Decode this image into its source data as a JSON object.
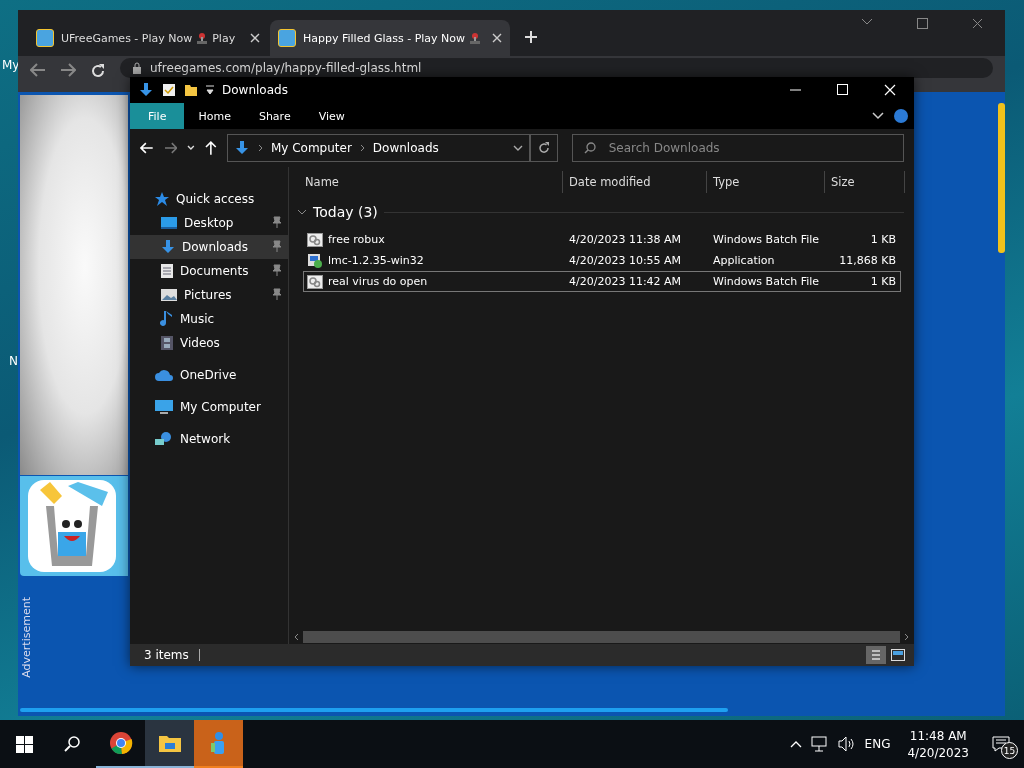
{
  "desktop": {
    "icon_labels": [
      "My",
      "N"
    ]
  },
  "browser": {
    "tabs": [
      {
        "title": "UFreeGames - Play Now",
        "suffix": "Play",
        "selected": false
      },
      {
        "title": "Happy Filled Glass - Play Now",
        "selected": true
      }
    ],
    "address": "ufreegames.com/play/happy-filled-glass.html",
    "page": {
      "ad_label": "Advertisement"
    }
  },
  "explorer": {
    "title": "Downloads",
    "ribbon_tabs": [
      {
        "label": "File",
        "selected": true
      },
      {
        "label": "Home",
        "selected": false
      },
      {
        "label": "Share",
        "selected": false
      },
      {
        "label": "View",
        "selected": false
      }
    ],
    "breadcrumb": [
      "My Computer",
      "Downloads"
    ],
    "search": {
      "placeholder": "Search Downloads"
    },
    "sidebar": [
      {
        "label": "Quick access",
        "children": [
          {
            "label": "Desktop",
            "pinned": true,
            "selected": false
          },
          {
            "label": "Downloads",
            "pinned": true,
            "selected": true
          },
          {
            "label": "Documents",
            "pinned": true,
            "selected": false
          },
          {
            "label": "Pictures",
            "pinned": true,
            "selected": false
          },
          {
            "label": "Music",
            "pinned": false,
            "selected": false
          },
          {
            "label": "Videos",
            "pinned": false,
            "selected": false
          }
        ]
      },
      {
        "label": "OneDrive"
      },
      {
        "label": "My Computer"
      },
      {
        "label": "Network"
      }
    ],
    "columns": [
      "Name",
      "Date modified",
      "Type",
      "Size"
    ],
    "group": {
      "label": "Today (3)",
      "expanded": true
    },
    "rows": [
      {
        "name": "free robux",
        "date": "4/20/2023 11:38 AM",
        "type": "Windows Batch File",
        "size": "1 KB",
        "kind": "batch",
        "focused": false
      },
      {
        "name": "lmc-1.2.35-win32",
        "date": "4/20/2023 10:55 AM",
        "type": "Application",
        "size": "11,868 KB",
        "kind": "app",
        "focused": false
      },
      {
        "name": "real virus do open",
        "date": "4/20/2023 11:42 AM",
        "type": "Windows Batch File",
        "size": "1 KB",
        "kind": "batch",
        "focused": true
      }
    ],
    "status": "3 items",
    "views": [
      {
        "kind": "details",
        "selected": true
      },
      {
        "kind": "tiles",
        "selected": false
      }
    ]
  },
  "taskbar": {
    "apps": [
      {
        "kind": "chrome",
        "active": false,
        "flashing": false
      },
      {
        "kind": "folder",
        "active": true,
        "flashing": false
      },
      {
        "kind": "figure",
        "active": false,
        "flashing": true
      }
    ],
    "language": "ENG",
    "time": "11:48 AM",
    "date": "4/20/2023",
    "notifications": "15"
  }
}
